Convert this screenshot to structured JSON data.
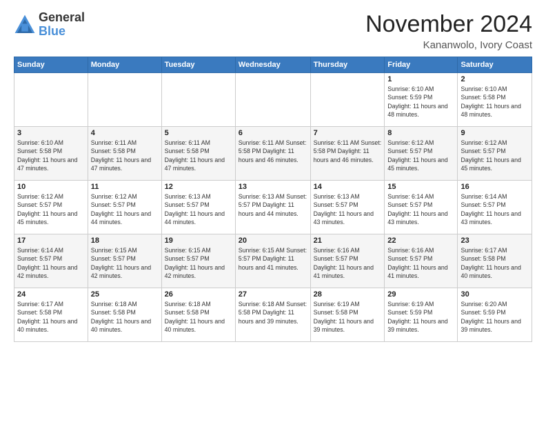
{
  "logo": {
    "general": "General",
    "blue": "Blue"
  },
  "header": {
    "month_title": "November 2024",
    "location": "Kananwolo, Ivory Coast"
  },
  "weekdays": [
    "Sunday",
    "Monday",
    "Tuesday",
    "Wednesday",
    "Thursday",
    "Friday",
    "Saturday"
  ],
  "weeks": [
    [
      {
        "day": "",
        "info": ""
      },
      {
        "day": "",
        "info": ""
      },
      {
        "day": "",
        "info": ""
      },
      {
        "day": "",
        "info": ""
      },
      {
        "day": "",
        "info": ""
      },
      {
        "day": "1",
        "info": "Sunrise: 6:10 AM\nSunset: 5:59 PM\nDaylight: 11 hours\nand 48 minutes."
      },
      {
        "day": "2",
        "info": "Sunrise: 6:10 AM\nSunset: 5:58 PM\nDaylight: 11 hours\nand 48 minutes."
      }
    ],
    [
      {
        "day": "3",
        "info": "Sunrise: 6:10 AM\nSunset: 5:58 PM\nDaylight: 11 hours\nand 47 minutes."
      },
      {
        "day": "4",
        "info": "Sunrise: 6:11 AM\nSunset: 5:58 PM\nDaylight: 11 hours\nand 47 minutes."
      },
      {
        "day": "5",
        "info": "Sunrise: 6:11 AM\nSunset: 5:58 PM\nDaylight: 11 hours\nand 47 minutes."
      },
      {
        "day": "6",
        "info": "Sunrise: 6:11 AM\nSunset: 5:58 PM\nDaylight: 11 hours\nand 46 minutes."
      },
      {
        "day": "7",
        "info": "Sunrise: 6:11 AM\nSunset: 5:58 PM\nDaylight: 11 hours\nand 46 minutes."
      },
      {
        "day": "8",
        "info": "Sunrise: 6:12 AM\nSunset: 5:57 PM\nDaylight: 11 hours\nand 45 minutes."
      },
      {
        "day": "9",
        "info": "Sunrise: 6:12 AM\nSunset: 5:57 PM\nDaylight: 11 hours\nand 45 minutes."
      }
    ],
    [
      {
        "day": "10",
        "info": "Sunrise: 6:12 AM\nSunset: 5:57 PM\nDaylight: 11 hours\nand 45 minutes."
      },
      {
        "day": "11",
        "info": "Sunrise: 6:12 AM\nSunset: 5:57 PM\nDaylight: 11 hours\nand 44 minutes."
      },
      {
        "day": "12",
        "info": "Sunrise: 6:13 AM\nSunset: 5:57 PM\nDaylight: 11 hours\nand 44 minutes."
      },
      {
        "day": "13",
        "info": "Sunrise: 6:13 AM\nSunset: 5:57 PM\nDaylight: 11 hours\nand 44 minutes."
      },
      {
        "day": "14",
        "info": "Sunrise: 6:13 AM\nSunset: 5:57 PM\nDaylight: 11 hours\nand 43 minutes."
      },
      {
        "day": "15",
        "info": "Sunrise: 6:14 AM\nSunset: 5:57 PM\nDaylight: 11 hours\nand 43 minutes."
      },
      {
        "day": "16",
        "info": "Sunrise: 6:14 AM\nSunset: 5:57 PM\nDaylight: 11 hours\nand 43 minutes."
      }
    ],
    [
      {
        "day": "17",
        "info": "Sunrise: 6:14 AM\nSunset: 5:57 PM\nDaylight: 11 hours\nand 42 minutes."
      },
      {
        "day": "18",
        "info": "Sunrise: 6:15 AM\nSunset: 5:57 PM\nDaylight: 11 hours\nand 42 minutes."
      },
      {
        "day": "19",
        "info": "Sunrise: 6:15 AM\nSunset: 5:57 PM\nDaylight: 11 hours\nand 42 minutes."
      },
      {
        "day": "20",
        "info": "Sunrise: 6:15 AM\nSunset: 5:57 PM\nDaylight: 11 hours\nand 41 minutes."
      },
      {
        "day": "21",
        "info": "Sunrise: 6:16 AM\nSunset: 5:57 PM\nDaylight: 11 hours\nand 41 minutes."
      },
      {
        "day": "22",
        "info": "Sunrise: 6:16 AM\nSunset: 5:57 PM\nDaylight: 11 hours\nand 41 minutes."
      },
      {
        "day": "23",
        "info": "Sunrise: 6:17 AM\nSunset: 5:58 PM\nDaylight: 11 hours\nand 40 minutes."
      }
    ],
    [
      {
        "day": "24",
        "info": "Sunrise: 6:17 AM\nSunset: 5:58 PM\nDaylight: 11 hours\nand 40 minutes."
      },
      {
        "day": "25",
        "info": "Sunrise: 6:18 AM\nSunset: 5:58 PM\nDaylight: 11 hours\nand 40 minutes."
      },
      {
        "day": "26",
        "info": "Sunrise: 6:18 AM\nSunset: 5:58 PM\nDaylight: 11 hours\nand 40 minutes."
      },
      {
        "day": "27",
        "info": "Sunrise: 6:18 AM\nSunset: 5:58 PM\nDaylight: 11 hours\nand 39 minutes."
      },
      {
        "day": "28",
        "info": "Sunrise: 6:19 AM\nSunset: 5:58 PM\nDaylight: 11 hours\nand 39 minutes."
      },
      {
        "day": "29",
        "info": "Sunrise: 6:19 AM\nSunset: 5:59 PM\nDaylight: 11 hours\nand 39 minutes."
      },
      {
        "day": "30",
        "info": "Sunrise: 6:20 AM\nSunset: 5:59 PM\nDaylight: 11 hours\nand 39 minutes."
      }
    ]
  ]
}
